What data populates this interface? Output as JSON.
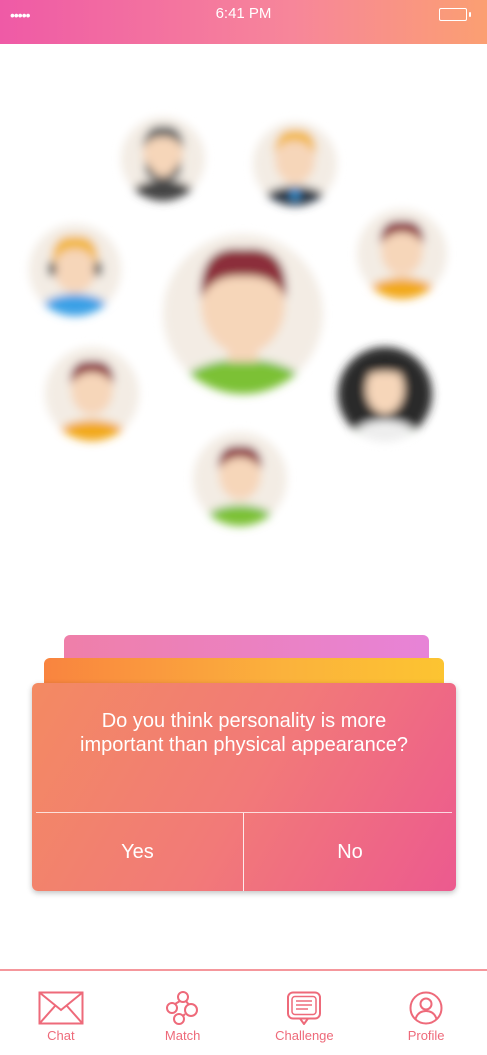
{
  "status_bar": {
    "signal": "•••••",
    "time": "6:41 PM"
  },
  "illustration": {
    "avatars": [
      {
        "name": "center-person",
        "hair": "#8c2f3a",
        "skin": "#f6d6b9",
        "shirt": "#7cc134",
        "bg": "#f3ece4"
      },
      {
        "name": "bearded-man",
        "hair": "#666666",
        "skin": "#f6d6b9",
        "shirt": "#444444",
        "bg": "#f3ece4"
      },
      {
        "name": "blond-man-suit",
        "hair": "#f2b743",
        "skin": "#f6d6b9",
        "shirt": "#2f3a4a",
        "bg": "#f3ece4"
      },
      {
        "name": "headset-woman",
        "hair": "#f2b743",
        "skin": "#f6d6b9",
        "shirt": "#3aa0e6",
        "bg": "#f3ece4"
      },
      {
        "name": "man-orange-shirt",
        "hair": "#8c2f3a",
        "skin": "#f6d6b9",
        "shirt": "#f2a91f",
        "bg": "#f3ece4"
      },
      {
        "name": "woman-orange-shirt",
        "hair": "#8c2f3a",
        "skin": "#f6d6b9",
        "shirt": "#f2a91f",
        "bg": "#f3ece4"
      },
      {
        "name": "dark-hair-woman",
        "hair": "#1b1b1b",
        "skin": "#f6d6b9",
        "shirt": "#eeeeee",
        "bg": "#2a2a2a"
      },
      {
        "name": "man-green-shirt",
        "hair": "#8c2f3a",
        "skin": "#f6d6b9",
        "shirt": "#7cc134",
        "bg": "#f3ece4"
      }
    ]
  },
  "card": {
    "question": "Do you think personality is more important than physical appearance?",
    "yes_label": "Yes",
    "no_label": "No"
  },
  "tab_bar": {
    "tabs": [
      {
        "label": "Chat",
        "icon": "envelope-icon"
      },
      {
        "label": "Match",
        "icon": "match-icon"
      },
      {
        "label": "Challenge",
        "icon": "chat-bubble-icon"
      },
      {
        "label": "Profile",
        "icon": "profile-icon"
      }
    ]
  },
  "colors": {
    "accent": "#ee6a7a",
    "status_bar_start": "#ef5aa6",
    "status_bar_end": "#fb9f72",
    "card_front_start": "#f38a62",
    "card_front_end": "#ec5a8f",
    "card_mid": "#fbb23c",
    "card_back": "#e783d7"
  }
}
